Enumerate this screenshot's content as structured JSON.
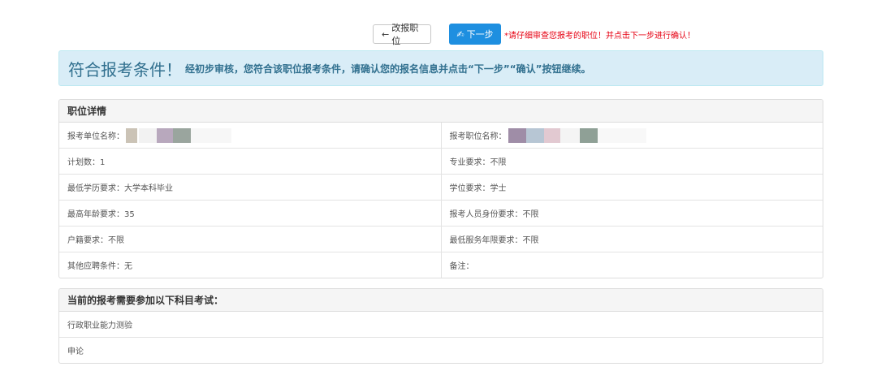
{
  "toolbar": {
    "back_label": "改报职位",
    "back_icon": "arrow-left-icon",
    "next_label": "下一步",
    "next_icon": "check-icon",
    "hint": "*请仔细审查您报考的职位！并点击下一步进行确认！"
  },
  "alert": {
    "title": "符合报考条件！",
    "message": "经初步审核，您符合该职位报考条件，请确认您的报名信息并点击“下一步”“确认”按钮继续。"
  },
  "details": {
    "header": "职位详情",
    "rows": [
      {
        "left": "报考单位名称：",
        "right": "报考职位名称："
      },
      {
        "left": "计划数：1",
        "right": "专业要求：不限"
      },
      {
        "left": "最低学历要求：大学本科毕业",
        "right": "学位要求：学士"
      },
      {
        "left": "最高年龄要求：35",
        "right": "报考人员身份要求：不限"
      },
      {
        "left": "户籍要求：不限",
        "right": "最低服务年限要求：不限"
      },
      {
        "left": "其他应聘条件：无",
        "right": "备注："
      }
    ]
  },
  "exams": {
    "header": "当前的报考需要参加以下科目考试：",
    "items": [
      "行政职业能力测验",
      "申论"
    ]
  },
  "colors": {
    "primary": "#1e8fe0",
    "alert_bg": "#d9edf7",
    "alert_text": "#31708f",
    "hint": "#e60012"
  }
}
